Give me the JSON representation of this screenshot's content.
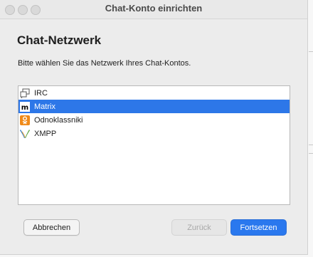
{
  "window": {
    "title": "Chat-Konto einrichten"
  },
  "page": {
    "heading": "Chat-Netzwerk",
    "subtitle": "Bitte wählen Sie das Netzwerk Ihres Chat-Kontos."
  },
  "networks": [
    {
      "label": "IRC",
      "icon": "irc-icon",
      "selected": false
    },
    {
      "label": "Matrix",
      "icon": "matrix-icon",
      "selected": true
    },
    {
      "label": "Odnoklassniki",
      "icon": "odnoklassniki-icon",
      "selected": false
    },
    {
      "label": "XMPP",
      "icon": "xmpp-icon",
      "selected": false
    }
  ],
  "buttons": {
    "cancel": "Abbrechen",
    "back": "Zurück",
    "next": "Fortsetzen"
  },
  "colors": {
    "selection": "#2d77e8",
    "primary_button": "#2a78ee",
    "odnoklassniki_orange": "#f08a18",
    "xmpp_green": "#5aa33c"
  }
}
